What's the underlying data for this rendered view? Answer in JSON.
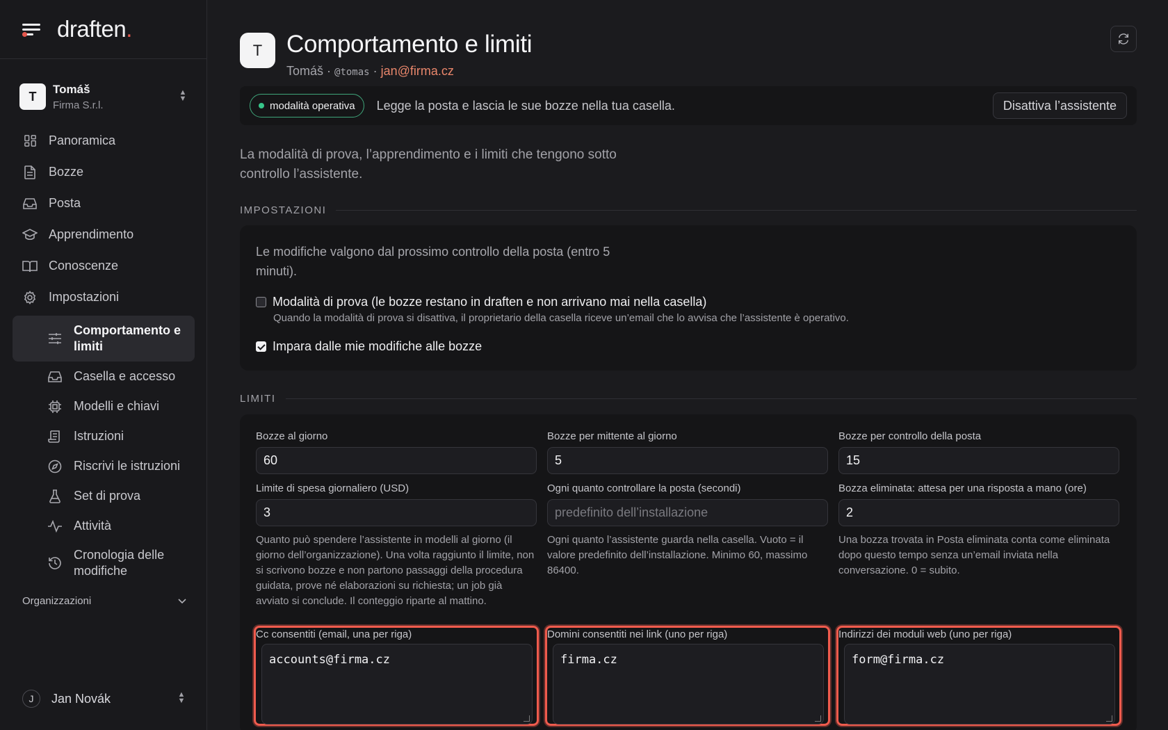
{
  "brand": {
    "name": "draften",
    "dot": "."
  },
  "account": {
    "initial": "T",
    "name": "Tomáš",
    "org": "Firma S.r.l."
  },
  "nav": [
    {
      "label": "Panoramica",
      "icon": "dashboard-icon"
    },
    {
      "label": "Bozze",
      "icon": "document-icon"
    },
    {
      "label": "Posta",
      "icon": "inbox-icon"
    },
    {
      "label": "Apprendimento",
      "icon": "graduation-cap-icon"
    },
    {
      "label": "Conoscenze",
      "icon": "book-icon"
    },
    {
      "label": "Impostazioni",
      "icon": "gear-icon"
    }
  ],
  "subnav": [
    {
      "label": "Comportamento e limiti",
      "icon": "sliders-icon",
      "active": true
    },
    {
      "label": "Casella e accesso",
      "icon": "inbox-icon"
    },
    {
      "label": "Modelli e chiavi",
      "icon": "chip-icon"
    },
    {
      "label": "Istruzioni",
      "icon": "scroll-icon"
    },
    {
      "label": "Riscrivi le istruzioni",
      "icon": "compass-icon"
    },
    {
      "label": "Set di prova",
      "icon": "flask-icon"
    },
    {
      "label": "Attività",
      "icon": "activity-icon"
    },
    {
      "label": "Cronologia delle modifiche",
      "icon": "history-icon"
    }
  ],
  "organizations_label": "Organizzazioni",
  "user": {
    "initial": "J",
    "name": "Jan Novák"
  },
  "header": {
    "initial": "T",
    "title": "Comportamento e limiti",
    "name": "Tomáš",
    "sep1": " · ",
    "handle": "@tomas",
    "sep2": " · ",
    "email": "jan@firma.cz"
  },
  "status": {
    "badge": "modalità operativa",
    "text": "Legge la posta e lascia le sue bozze nella tua casella.",
    "deactivate": "Disattiva l’assistente",
    "badge_color": "#37c68a"
  },
  "intro": "La modalità di prova, l’apprendimento e i limiti che tengono sotto controllo l’assistente.",
  "settings": {
    "heading": "IMPOSTAZIONI",
    "note": "Le modifiche valgono dal prossimo controllo della posta (entro 5 minuti).",
    "test_mode": {
      "label": "Modalità di prova (le bozze restano in draften e non arrivano mai nella casella)",
      "checked": false,
      "help": "Quando la modalità di prova si disattiva, il proprietario della casella riceve un’email che lo avvisa che l’assistente è operativo."
    },
    "learn": {
      "label": "Impara dalle mie modifiche alle bozze",
      "checked": true
    }
  },
  "limits": {
    "heading": "LIMITI",
    "fields": [
      {
        "label": "Bozze al giorno",
        "value": "60"
      },
      {
        "label": "Bozze per mittente al giorno",
        "value": "5"
      },
      {
        "label": "Bozze per controllo della posta",
        "value": "15"
      },
      {
        "label": "Limite di spesa giornaliero (USD)",
        "value": "3",
        "help": "Quanto può spendere l’assistente in modelli al giorno (il giorno dell’organizzazione). Una volta raggiunto il limite, non si scrivono bozze e non partono passaggi della procedura guidata, prove né elaborazioni su richiesta; un job già avviato si conclude. Il conteggio riparte al mattino."
      },
      {
        "label": "Ogni quanto controllare la posta (secondi)",
        "placeholder": "predefinito dell’installazione",
        "help": "Ogni quanto l’assistente guarda nella casella. Vuoto = il valore predefinito dell’installazione. Minimo 60, massimo 86400."
      },
      {
        "label": "Bozza eliminata: attesa per una risposta a mano (ore)",
        "value": "2",
        "help": "Una bozza trovata in Posta eliminata conta come eliminata dopo questo tempo senza un’email inviata nella conversazione. 0 = subito."
      }
    ],
    "textareas": [
      {
        "label": "Cc consentiti (email, una per riga)",
        "value": "accounts@firma.cz"
      },
      {
        "label": "Domini consentiti nei link (uno per riga)",
        "value": "firma.cz"
      },
      {
        "label": "Indirizzi dei moduli web (uno per riga)",
        "value": "form@firma.cz"
      }
    ]
  },
  "colors": {
    "accent": "#e4574d",
    "highlight": "#ef5b4d",
    "email": "#e8866b"
  }
}
